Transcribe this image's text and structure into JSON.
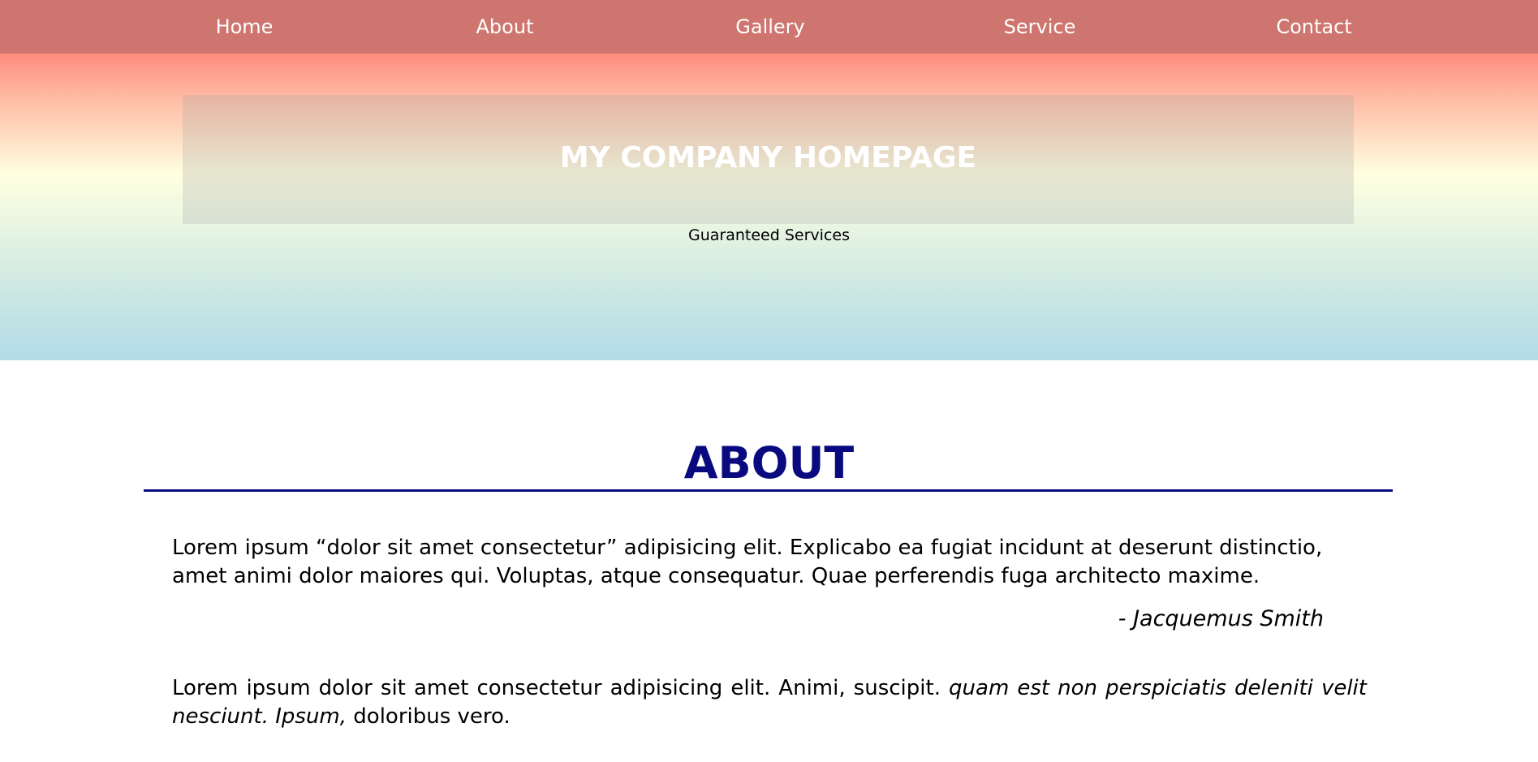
{
  "nav": {
    "items": [
      {
        "label": "Home"
      },
      {
        "label": "About"
      },
      {
        "label": "Gallery"
      },
      {
        "label": "Service"
      },
      {
        "label": "Contact"
      }
    ]
  },
  "hero": {
    "title": "MY COMPANY HOMEPAGE",
    "subtitle": "Guaranteed Services"
  },
  "about": {
    "heading": "ABOUT",
    "paragraph1": "Lorem ipsum “dolor sit amet consectetur” adipisicing elit. Explicabo ea fugiat incidunt at deserunt distinctio, amet animi dolor maiores qui. Voluptas, atque consequatur. Quae perferendis fuga architecto maxime.",
    "quote_author": "- Jacquemus Smith",
    "paragraph2": {
      "part1": "Lorem ipsum dolor sit amet consectetur adipisicing elit. Animi, suscipit. ",
      "part2_italic": "quam est non perspiciatis deleniti velit nesciunt. Ipsum,",
      "part3": " doloribus vero."
    }
  },
  "colors": {
    "navbar": "#cd756e",
    "heading": "#0a0a80",
    "gradient_top": "#ff8c7e",
    "gradient_middle": "#ffffe0",
    "gradient_bottom": "#b1dbe8"
  }
}
